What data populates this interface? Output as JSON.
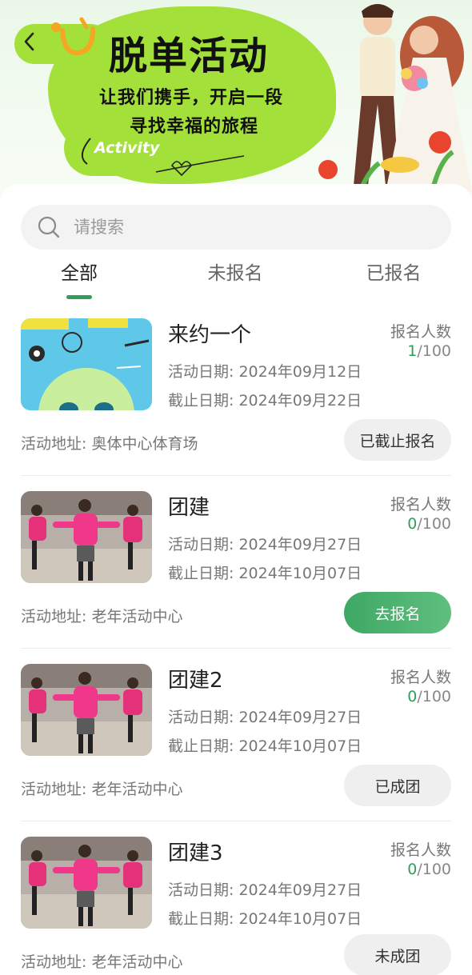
{
  "banner": {
    "title": "脱单活动",
    "line1": "让我们携手，开启一段",
    "line2": "寻找幸福的旅程",
    "tag": "Activity",
    "back_icon": "chevron-left-icon"
  },
  "search": {
    "placeholder": "请搜索",
    "value": "",
    "icon": "search-icon"
  },
  "tabs": [
    {
      "label": "全部",
      "active": true
    },
    {
      "label": "未报名",
      "active": false
    },
    {
      "label": "已报名",
      "active": false
    }
  ],
  "activities": [
    {
      "name": "来约一个",
      "date_label": "活动日期:",
      "date": "2024年09月12日",
      "end_label": "截止日期:",
      "end": "2024年09月22日",
      "count_label": "报名人数",
      "count": "1",
      "capacity": "/100",
      "address_label": "活动地址:",
      "address": "奥体中心体育场",
      "button": "已截止报名",
      "button_style": "gray",
      "image": "cartoon-thumbnail"
    },
    {
      "name": "团建",
      "date_label": "活动日期:",
      "date": "2024年09月27日",
      "end_label": "截止日期:",
      "end": "2024年10月07日",
      "count_label": "报名人数",
      "count": "0",
      "capacity": "/100",
      "address_label": "活动地址:",
      "address": "老年活动中心",
      "button": "去报名",
      "button_style": "primary",
      "image": "dance-thumbnail"
    },
    {
      "name": "团建2",
      "date_label": "活动日期:",
      "date": "2024年09月27日",
      "end_label": "截止日期:",
      "end": "2024年10月07日",
      "count_label": "报名人数",
      "count": "0",
      "capacity": "/100",
      "address_label": "活动地址:",
      "address": "老年活动中心",
      "button": "已成团",
      "button_style": "gray",
      "image": "dance-thumbnail"
    },
    {
      "name": "团建3",
      "date_label": "活动日期:",
      "date": "2024年09月27日",
      "end_label": "截止日期:",
      "end": "2024年10月07日",
      "count_label": "报名人数",
      "count": "0",
      "capacity": "/100",
      "address_label": "活动地址:",
      "address": "老年活动中心",
      "button": "未成团",
      "button_style": "gray",
      "image": "dance-thumbnail"
    }
  ],
  "colors": {
    "accent": "#2f9e5b",
    "banner_green": "#a4e03a",
    "primary_button": "#4aae6e"
  }
}
